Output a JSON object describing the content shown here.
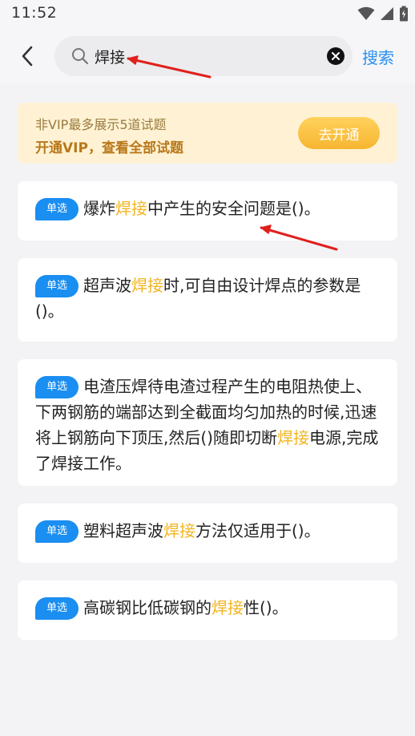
{
  "status_bar": {
    "time": "11:52",
    "icons": [
      "wifi-icon",
      "signal-icon",
      "battery-icon"
    ]
  },
  "header": {
    "back_icon": "chevron-left-icon",
    "search": {
      "value": "焊接",
      "placeholder": "",
      "icon": "search-icon",
      "clear_icon": "close-icon"
    },
    "search_button": "搜索"
  },
  "vip_banner": {
    "line1": "非VIP最多展示5道试题",
    "line2": "开通VIP，查看全部试题",
    "button": "去开通"
  },
  "questions": [
    {
      "badge": "单选",
      "pre": "爆炸",
      "keyword": "焊接",
      "post": "中产生的安全问题是()。"
    },
    {
      "badge": "单选",
      "pre": "超声波",
      "keyword": "焊接",
      "post": "时,可自由设计焊点的参数是()。"
    },
    {
      "badge": "单选",
      "pre": "电渣压焊待电渣过程产生的电阻热使上、下两钢筋的端部达到全截面均匀加热的时候,迅速将上钢筋向下顶压,然后()随即切断",
      "keyword": "焊接",
      "post": "电源,完成了焊接工作。"
    },
    {
      "badge": "单选",
      "pre": "塑料超声波",
      "keyword": "焊接",
      "post": "方法仅适用于()。"
    },
    {
      "badge": "单选",
      "pre": "高碳钢比低碳钢的",
      "keyword": "焊接",
      "post": "性()。"
    }
  ],
  "colors": {
    "accent": "#1a8ef1",
    "highlight": "#f2b520",
    "vip_background": "#fff2d4",
    "annotation_arrow": "#e0201c"
  }
}
